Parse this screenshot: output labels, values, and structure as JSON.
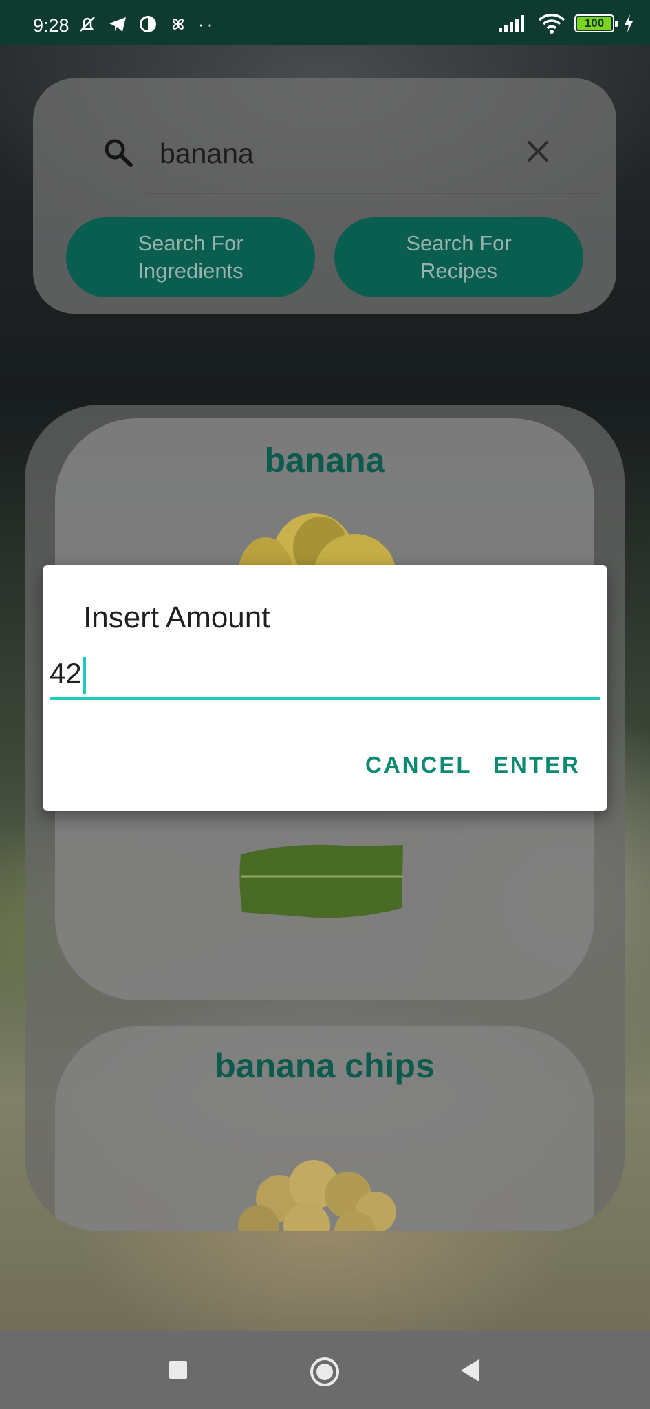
{
  "status": {
    "time": "9:28",
    "battery": "100",
    "icons_left": [
      "mute-bell-icon",
      "telegram-icon",
      "app-icon",
      "fan-icon",
      "more-dots-icon"
    ],
    "icons_right": [
      "signal-icon",
      "wifi-icon",
      "battery-icon",
      "charging-icon"
    ]
  },
  "search": {
    "query": "banana",
    "btn_ingredients": "Search For Ingredients",
    "btn_recipes": "Search For Recipes"
  },
  "results": [
    {
      "title": "banana"
    },
    {
      "title": "banana chips"
    }
  ],
  "dialog": {
    "title": "Insert Amount",
    "value": "42",
    "cancel": "CANCEL",
    "enter": "ENTER"
  },
  "colors": {
    "accent": "#0b8a72",
    "input_line": "#1ec9be",
    "status_bar": "#0e3a30",
    "pill": "#0a5e50"
  }
}
